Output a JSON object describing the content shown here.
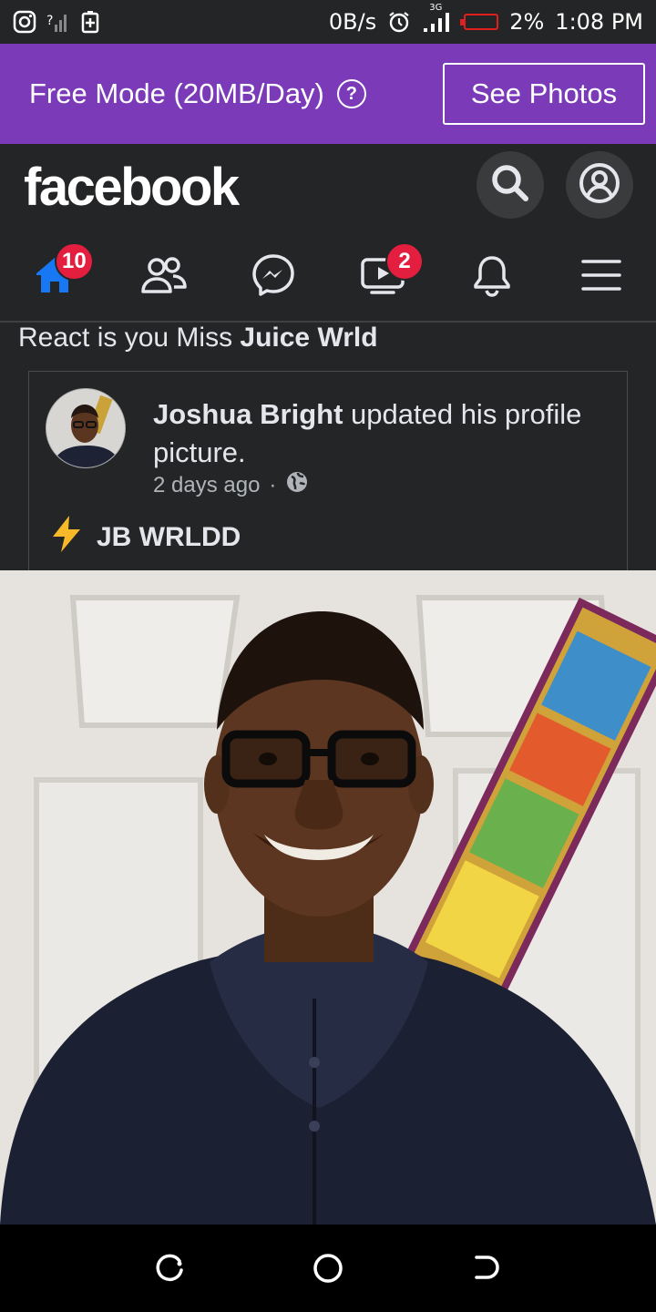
{
  "status_bar": {
    "data_rate": "0B/s",
    "network": "3G",
    "battery": "2%",
    "time": "1:08 PM"
  },
  "free_mode": {
    "label": "Free Mode (20MB/Day)",
    "help_glyph": "?",
    "button_label": "See Photos"
  },
  "header": {
    "logo": "facebook",
    "search_icon": "search-icon",
    "profile_icon": "profile-icon"
  },
  "nav": {
    "home_badge": "10",
    "watch_badge": "2",
    "active_tab": "home",
    "accent_color": "#1877f2"
  },
  "post": {
    "context_prefix": "React is you Miss ",
    "context_name": "Juice Wrld",
    "author": "Joshua Bright",
    "action": " updated his profile picture.",
    "time": "2 days ago",
    "separator": "·",
    "bio": "JB WRLDD"
  }
}
